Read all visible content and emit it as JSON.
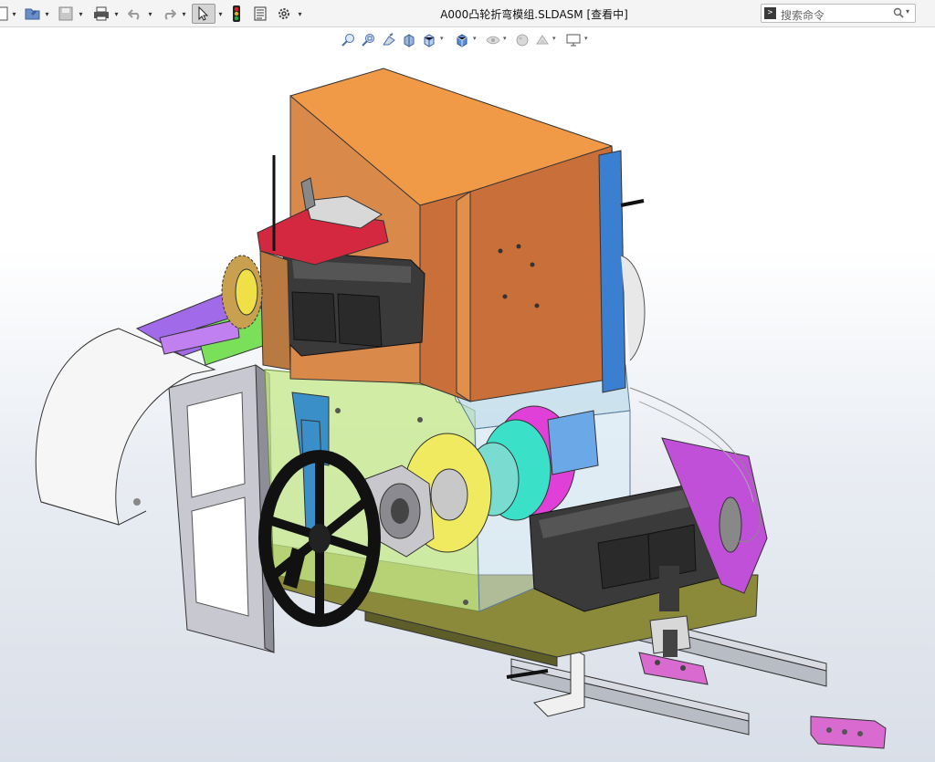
{
  "toolbar": {
    "buttons": [
      {
        "name": "new-document-icon",
        "has_menu": true
      },
      {
        "name": "open-folder-icon",
        "has_menu": true
      },
      {
        "name": "save-icon",
        "has_menu": true
      },
      {
        "name": "print-icon",
        "has_menu": true
      },
      {
        "name": "undo-icon",
        "has_menu": true
      },
      {
        "name": "redo-icon",
        "has_menu": true
      },
      {
        "name": "select-pointer-icon",
        "has_menu": true,
        "active": true
      },
      {
        "name": "rebuild-traffic-light-icon",
        "has_menu": false
      },
      {
        "name": "file-properties-icon",
        "has_menu": false
      },
      {
        "name": "options-gear-icon",
        "has_menu": true
      }
    ]
  },
  "title": "A000凸轮折弯模组.SLDASM [查看中]",
  "search": {
    "placeholder": "搜索命令",
    "prompt_glyph": ">"
  },
  "view_toolbar": [
    {
      "name": "zoom-to-fit-icon"
    },
    {
      "name": "zoom-to-area-icon"
    },
    {
      "name": "previous-view-icon"
    },
    {
      "name": "section-view-icon"
    },
    {
      "name": "view-orientation-icon"
    },
    {
      "name": "display-style-icon"
    },
    {
      "name": "hide-show-items-icon"
    },
    {
      "name": "edit-appearance-icon"
    },
    {
      "name": "apply-scene-icon"
    },
    {
      "name": "view-settings-icon"
    }
  ],
  "colors": {
    "toolbar_bg": "#f4f4f4",
    "housing_orange": "#e8914a",
    "housing_orange_dark": "#c8702e",
    "panel_blue": "#3a7fd0",
    "plate_magenta": "#d23ad0",
    "plate_purple": "#9a4fe0",
    "transparent_green": "#b7e07a",
    "motor_dark": "#2a2a2a",
    "frame_gray": "#b0b0b8",
    "gear_yellow": "#e8e03a",
    "cam_cyan": "#3ae0c8",
    "cam_pink": "#e83ad8",
    "red_plate": "#d4283a"
  }
}
